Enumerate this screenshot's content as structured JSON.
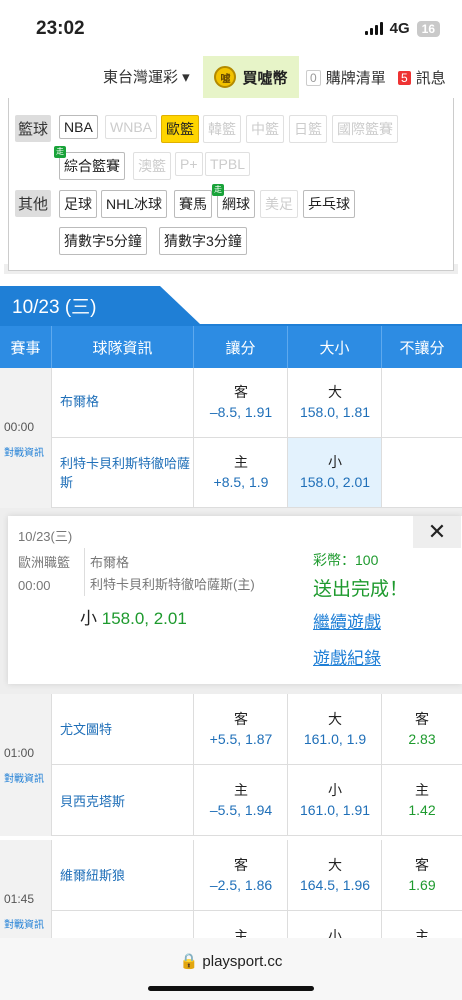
{
  "status": {
    "time": "23:02",
    "network": "4G",
    "battery": "16"
  },
  "nav": {
    "lottery": "東台灣運彩 ▾",
    "buy": "買噓幣",
    "coin_glyph": "噓",
    "cart_count": "0",
    "cart": "購牌清單",
    "msg_count": "5",
    "msg": "訊息"
  },
  "filters": {
    "basketball_label": "籃球",
    "basketball": [
      "NBA",
      "WNBA",
      "歐籃",
      "韓籃",
      "中籃",
      "日籃",
      "國際籃賽",
      "綜合籃賽",
      "澳籃",
      "P+",
      "TPBL"
    ],
    "other_label": "其他",
    "other": [
      "足球",
      "NHL冰球",
      "賽馬",
      "網球",
      "美足",
      "乒乓球",
      "猜數字5分鐘",
      "猜數字3分鐘"
    ],
    "walk_badge": "走"
  },
  "date_tab": "10/23 (三)",
  "table_headers": [
    "賽事",
    "球隊資訊",
    "讓分",
    "大小",
    "不讓分"
  ],
  "matches": [
    {
      "time": "00:00",
      "report": "對戰資訊",
      "away": {
        "team": "布爾格",
        "spread_k": "客",
        "spread": "–8.5, 1.91",
        "total_k": "大",
        "total": "158.0, 1.81",
        "ml_k": "",
        "ml": ""
      },
      "home": {
        "team": "利特卡貝利斯特徹哈薩斯",
        "spread_k": "主",
        "spread": "+8.5, 1.9",
        "total_k": "小",
        "total": "158.0, 2.01",
        "ml_k": "",
        "ml": ""
      }
    },
    {
      "time": "01:00",
      "report": "對戰資訊",
      "away": {
        "team": "尤文圖特",
        "spread_k": "客",
        "spread": "+5.5, 1.87",
        "total_k": "大",
        "total": "161.0, 1.9",
        "ml_k": "客",
        "ml": "2.83"
      },
      "home": {
        "team": "貝西克塔斯",
        "spread_k": "主",
        "spread": "–5.5, 1.94",
        "total_k": "小",
        "total": "161.0, 1.91",
        "ml_k": "主",
        "ml": "1.42"
      }
    },
    {
      "time": "01:45",
      "report": "對戰資訊",
      "away": {
        "team": "維爾紐斯狼",
        "spread_k": "客",
        "spread": "–2.5, 1.86",
        "total_k": "大",
        "total": "164.5, 1.96",
        "ml_k": "客",
        "ml": "1.69"
      },
      "home": {
        "team": "",
        "spread_k": "主",
        "spread": "",
        "total_k": "小",
        "total": "",
        "ml_k": "主",
        "ml": ""
      }
    }
  ],
  "popup": {
    "date": "10/23(三)",
    "league": "歐洲職籃",
    "time": "00:00",
    "team1": "布爾格",
    "team2": "利特卡貝利斯特徹哈薩斯(主)",
    "bet_side": "小",
    "bet_value": "158.0, 2.01",
    "coins": "彩幣：100",
    "done": "送出完成！",
    "continue": "繼續遊戲",
    "records": "遊戲紀錄",
    "close": "✕"
  },
  "url": "🔒 playsport.cc",
  "colors": {
    "accent": "#1f7fd6",
    "green": "#1e9a2e",
    "highlight": "#ffd500"
  }
}
